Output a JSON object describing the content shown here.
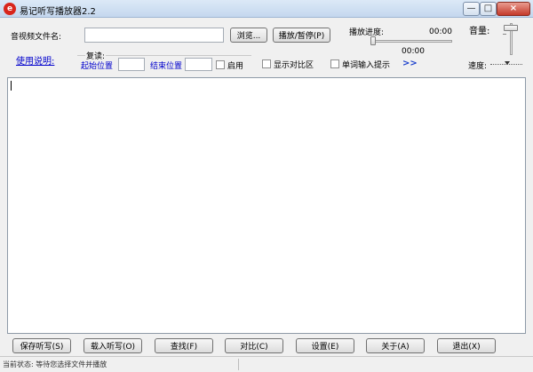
{
  "window": {
    "title": "易记听写播放器2.2",
    "icon_letter": "e",
    "minimize_glyph": "—",
    "maximize_glyph": "□",
    "close_glyph": "×"
  },
  "file": {
    "label": "音视频文件名:",
    "value": "",
    "browse_button": "浏览...",
    "play_pause_button": "播放/暂停(P)"
  },
  "playback": {
    "progress_label": "播放进度:",
    "current_time": "00:00",
    "total_time": "00:00",
    "progress_fraction": 0
  },
  "volume": {
    "label": "音量:",
    "level_fraction": 1.0
  },
  "speed": {
    "label": "速度:"
  },
  "help_link": "使用说明:",
  "repeat": {
    "group_label": "复读:",
    "start_label": "起始位置",
    "start_value": "",
    "end_label": "结束位置",
    "end_value": "",
    "enable_label": "启用",
    "enable_checked": false
  },
  "options": {
    "show_compare_label": "显示对比区",
    "show_compare_checked": false,
    "word_input_hint_label": "单词输入提示",
    "word_input_hint_checked": false,
    "expand_arrows": ">>"
  },
  "editor": {
    "content": ""
  },
  "buttons": {
    "save": "保存听写(S)",
    "load": "载入听写(O)",
    "find": "查找(F)",
    "compare": "对比(C)",
    "settings": "设置(E)",
    "about": "关于(A)",
    "exit": "退出(X)"
  },
  "status": {
    "text": "当前状态: 等待您选择文件并播放"
  }
}
